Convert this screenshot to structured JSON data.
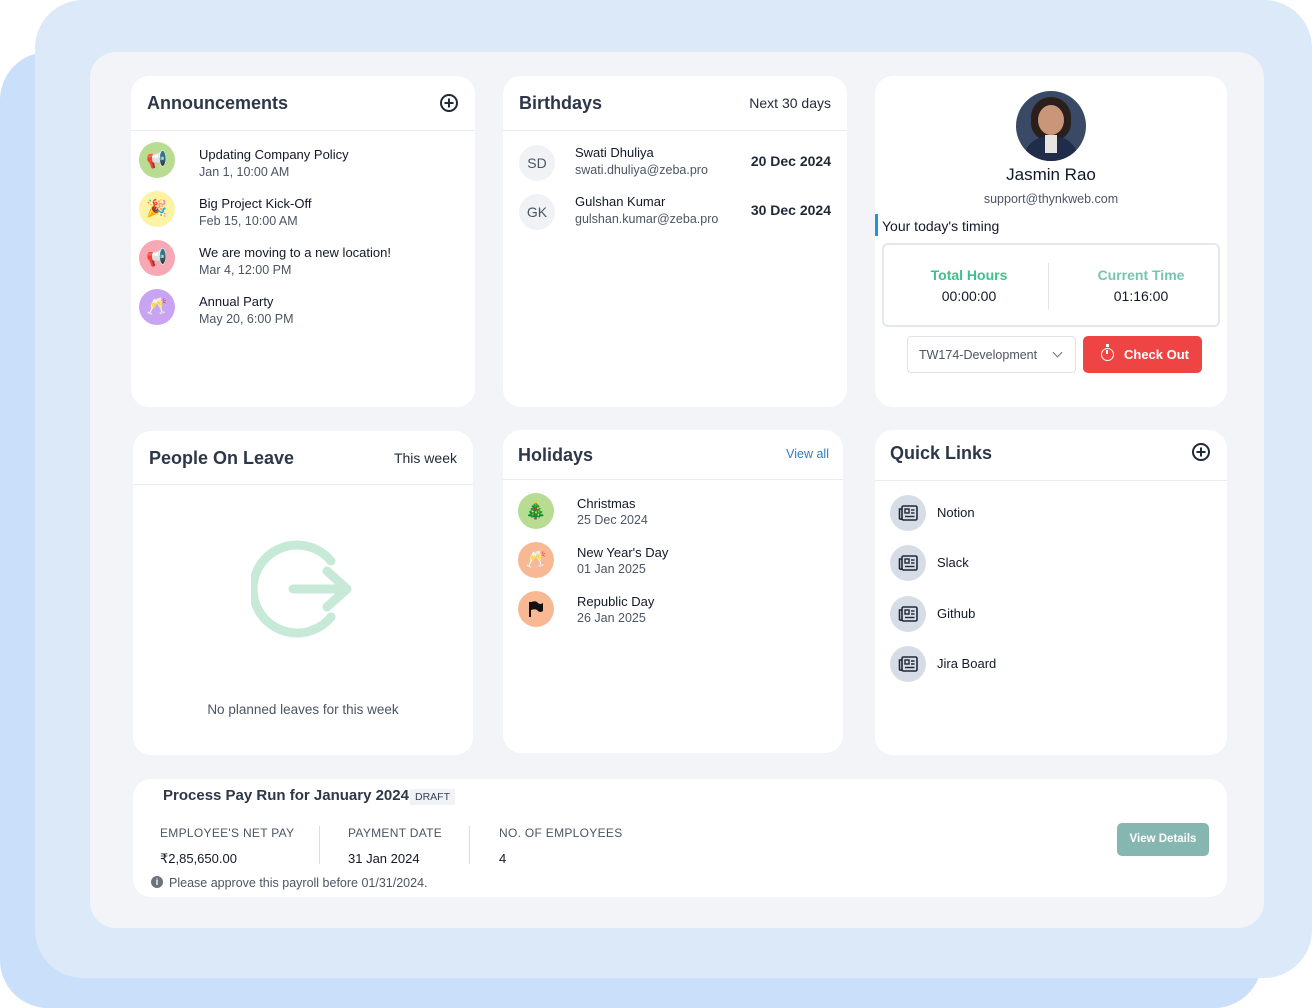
{
  "announcements": {
    "title": "Announcements",
    "items": [
      {
        "title": "Updating Company Policy",
        "date": "Jan 1, 10:00 AM",
        "icon": "megaphone-icon",
        "color": "#b7dc92"
      },
      {
        "title": "Big Project Kick-Off",
        "date": "Feb 15, 10:00 AM",
        "icon": "party-popper-icon",
        "color": "#fbf3a6"
      },
      {
        "title": "We are moving to a new location!",
        "date": "Mar 4, 12:00 PM",
        "icon": "megaphone-icon",
        "color": "#f6a9b4"
      },
      {
        "title": "Annual Party",
        "date": "May 20, 6:00 PM",
        "icon": "cheers-icon",
        "color": "#c9a4f2"
      }
    ]
  },
  "birthdays": {
    "title": "Birthdays",
    "range": "Next 30 days",
    "items": [
      {
        "initials": "SD",
        "name": "Swati Dhuliya",
        "email": "swati.dhuliya@zeba.pro",
        "date": "20 Dec 2024"
      },
      {
        "initials": "GK",
        "name": "Gulshan Kumar",
        "email": "gulshan.kumar@zeba.pro",
        "date": "30 Dec 2024"
      }
    ]
  },
  "profile": {
    "name": "Jasmin Rao",
    "email": "support@thynkweb.com",
    "timing_heading": "Your today's timing",
    "total_hours_label": "Total Hours",
    "total_hours": "00:00:00",
    "current_time_label": "Current Time",
    "current_time": "01:16:00",
    "project": "TW174-Development",
    "checkout_label": "Check Out",
    "colors": {
      "total": "#3fbf8c",
      "current": "#77c5ad",
      "checkout": "#ef4444"
    }
  },
  "leave": {
    "title": "People On Leave",
    "range": "This week",
    "empty_text": "No planned leaves for this week",
    "icon": "exit-arrow-icon"
  },
  "holidays": {
    "title": "Holidays",
    "view_all": "View all",
    "items": [
      {
        "name": "Christmas",
        "date": "25 Dec 2024",
        "icon": "christmas-tree-icon",
        "color": "#b7dc92"
      },
      {
        "name": "New Year's Day",
        "date": "01 Jan 2025",
        "icon": "cheers-icon",
        "color": "#f8b894"
      },
      {
        "name": "Republic Day",
        "date": "26 Jan 2025",
        "icon": "flag-icon",
        "color": "#f8b894"
      }
    ]
  },
  "quick_links": {
    "title": "Quick Links",
    "items": [
      {
        "label": "Notion",
        "icon": "newspaper-icon"
      },
      {
        "label": "Slack",
        "icon": "newspaper-icon"
      },
      {
        "label": "Github",
        "icon": "newspaper-icon"
      },
      {
        "label": "Jira Board",
        "icon": "newspaper-icon"
      }
    ]
  },
  "payrun": {
    "title": "Process Pay Run for January 2024",
    "status": "DRAFT",
    "net_pay_label": "EMPLOYEE'S NET PAY",
    "net_pay": "₹2,85,650.00",
    "payment_date_label": "PAYMENT DATE",
    "payment_date": "31 Jan 2024",
    "employees_label": "NO. OF EMPLOYEES",
    "employees": "4",
    "notice": "Please approve this payroll before 01/31/2024.",
    "view_details": "View Details"
  }
}
